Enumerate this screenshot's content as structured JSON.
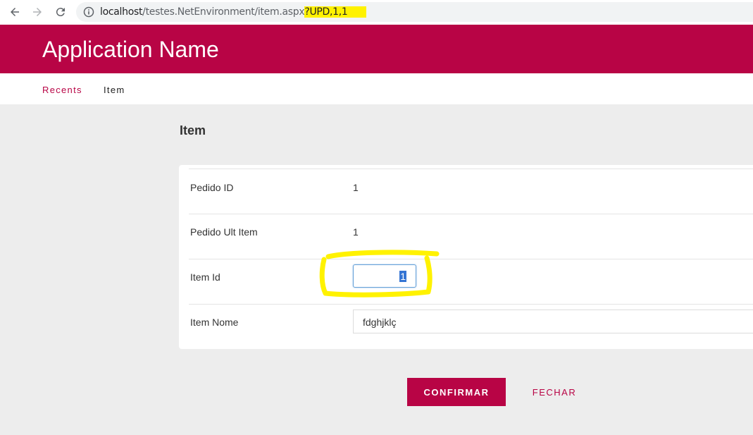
{
  "browser": {
    "url_host": "localhost",
    "url_path": "/testes.NetEnvironment/item.aspx",
    "url_query": "?UPD,1,1"
  },
  "app": {
    "title": "Application Name"
  },
  "tabs": [
    {
      "label": "Recents"
    },
    {
      "label": "Item"
    }
  ],
  "page": {
    "title": "Item"
  },
  "form": {
    "pedido_id": {
      "label": "Pedido ID",
      "value": "1"
    },
    "pedido_ult_item": {
      "label": "Pedido Ult Item",
      "value": "1"
    },
    "item_id": {
      "label": "Item Id",
      "value": "1"
    },
    "item_nome": {
      "label": "Item Nome",
      "value": "fdghjklç"
    }
  },
  "actions": {
    "confirm_label": "CONFIRMAR",
    "close_label": "FECHAR"
  },
  "colors": {
    "brand": "#b80445",
    "highlight": "#fff200"
  }
}
